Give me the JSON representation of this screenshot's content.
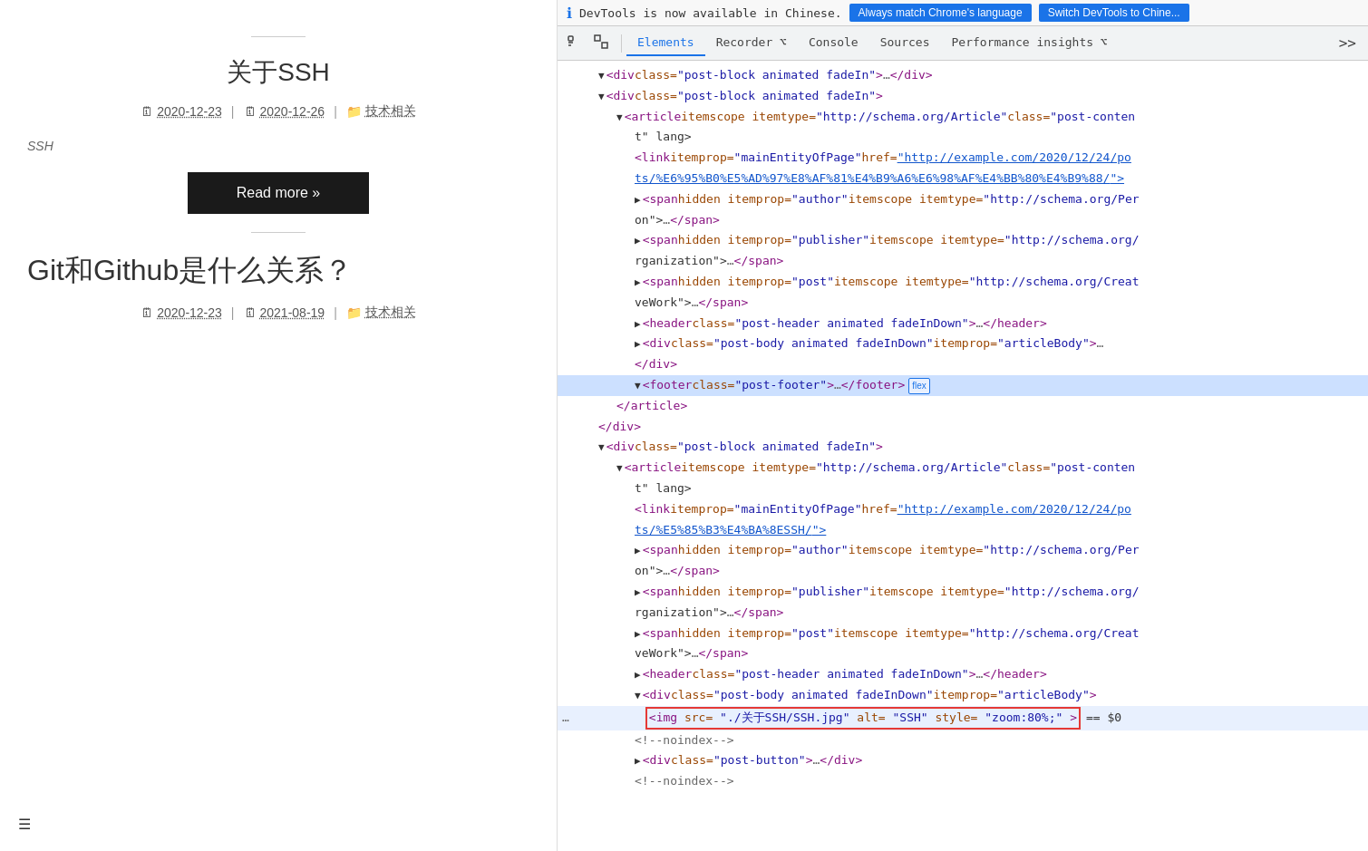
{
  "left_panel": {
    "post1": {
      "title": "关于SSH",
      "date_created": "2020-12-23",
      "date_updated": "2020-12-26",
      "category": "技术相关",
      "image_alt": "SSH",
      "read_more_label": "Read more »"
    },
    "post2": {
      "title": "Git和Github是什么关系？",
      "date_created": "2020-12-23",
      "date_updated": "2021-08-19",
      "category": "技术相关"
    }
  },
  "devtools": {
    "top_bar": {
      "message": "DevTools is now available in Chinese.",
      "btn_always_match": "Always match Chrome's language",
      "btn_switch": "Switch DevTools to Chine..."
    },
    "tabs": {
      "items": [
        {
          "label": "Elements",
          "active": true
        },
        {
          "label": "Recorder ⌥",
          "active": false
        },
        {
          "label": "Console",
          "active": false
        },
        {
          "label": "Sources",
          "active": false
        },
        {
          "label": "Performance insights ⌥",
          "active": false
        }
      ],
      "overflow_label": ">>"
    },
    "html_lines": [
      {
        "indent": 4,
        "content": "▼<div class=\"post-block animated fadeIn\"> … </div>",
        "type": "tag"
      },
      {
        "indent": 4,
        "content": "▼<div class=\"post-block animated fadeIn\">",
        "type": "tag"
      },
      {
        "indent": 6,
        "content": "▼<article itemscope itemtype=\"http://schema.org/Article\" class=\"post-conten",
        "type": "tag"
      },
      {
        "indent": 7,
        "content": "t\" lang>",
        "type": "tag-continuation"
      },
      {
        "indent": 8,
        "content": "<link itemprop=\"mainEntityOfPage\" href=\"http://example.com/2020/12/24/po",
        "type": "tag-link"
      },
      {
        "indent": 8,
        "content": "ts/%E6%95%B0%E5%AD%97%E8%AF%81%E4%B9%A6%E6%98%AF%E4%BB%80%E4%B9%88/\">",
        "type": "tag-link-continuation"
      },
      {
        "indent": 8,
        "content": "▶<span hidden itemprop=\"author\" itemscope itemtype=\"http://schema.org/Per",
        "type": "tag"
      },
      {
        "indent": 8,
        "content": "on\"> … </span>",
        "type": "tag-continuation"
      },
      {
        "indent": 8,
        "content": "▶<span hidden itemprop=\"publisher\" itemscope itemtype=\"http://schema.org/",
        "type": "tag"
      },
      {
        "indent": 8,
        "content": "rganization\"> … </span>",
        "type": "tag-continuation"
      },
      {
        "indent": 8,
        "content": "▶<span hidden itemprop=\"post\" itemscope itemtype=\"http://schema.org/Creat",
        "type": "tag"
      },
      {
        "indent": 8,
        "content": "veWork\"> … </span>",
        "type": "tag-continuation"
      },
      {
        "indent": 8,
        "content": "▶<header class=\"post-header animated fadeInDown\"> … </header>",
        "type": "tag"
      },
      {
        "indent": 8,
        "content": "▶<div class=\"post-body animated fadeInDown\" itemprop=\"articleBody\"> …",
        "type": "tag"
      },
      {
        "indent": 8,
        "content": "</div>",
        "type": "tag-continuation"
      },
      {
        "indent": 8,
        "content": "▼<footer class=\"post-footer\"> … </footer>",
        "type": "tag-highlight",
        "badge": "flex"
      },
      {
        "indent": 7,
        "content": "</article>",
        "type": "tag"
      },
      {
        "indent": 6,
        "content": "</div>",
        "type": "tag"
      },
      {
        "indent": 4,
        "content": "▼<div class=\"post-block animated fadeIn\">",
        "type": "tag"
      },
      {
        "indent": 6,
        "content": "▼<article itemscope itemtype=\"http://schema.org/Article\" class=\"post-conten",
        "type": "tag"
      },
      {
        "indent": 7,
        "content": "t\" lang>",
        "type": "tag-continuation"
      },
      {
        "indent": 8,
        "content": "<link itemprop=\"mainEntityOfPage\" href=\"http://example.com/2020/12/24/po",
        "type": "tag-link"
      },
      {
        "indent": 8,
        "content": "ts/%E5%85%B3%E4%BA%8ESSH/\">",
        "type": "tag-link-continuation"
      },
      {
        "indent": 8,
        "content": "▶<span hidden itemprop=\"author\" itemscope itemtype=\"http://schema.org/Per",
        "type": "tag"
      },
      {
        "indent": 8,
        "content": "on\"> … </span>",
        "type": "tag-continuation"
      },
      {
        "indent": 8,
        "content": "▶<span hidden itemprop=\"publisher\" itemscope itemtype=\"http://schema.org/",
        "type": "tag"
      },
      {
        "indent": 8,
        "content": "rganization\"> … </span>",
        "type": "tag-continuation"
      },
      {
        "indent": 8,
        "content": "▶<span hidden itemprop=\"post\" itemscope itemtype=\"http://schema.org/Creat",
        "type": "tag"
      },
      {
        "indent": 8,
        "content": "veWork\"> … </span>",
        "type": "tag-continuation"
      },
      {
        "indent": 8,
        "content": "▶<header class=\"post-header animated fadeInDown\"> … </header>",
        "type": "tag"
      },
      {
        "indent": 8,
        "content": "▼<div class=\"post-body animated fadeInDown\" itemprop=\"articleBody\">",
        "type": "tag"
      },
      {
        "indent": 9,
        "content": "<img src=\"./关于SSH/SSH.jpg\" alt=\"SSH\" style=\"zoom:80%;\">  == $0",
        "type": "tag-selected"
      },
      {
        "indent": 8,
        "content": "<!--noindex-->",
        "type": "comment"
      },
      {
        "indent": 8,
        "content": "▶<div class=\"post-button\"> … </div>",
        "type": "tag"
      },
      {
        "indent": 8,
        "content": "<!--noindex-->",
        "type": "comment"
      }
    ],
    "bottom_bar": {
      "ellipsis": "…"
    }
  },
  "icons": {
    "cursor": "⬝",
    "box": "⬜",
    "calendar": "📅",
    "folder": "📁",
    "hamburger": "☰"
  }
}
